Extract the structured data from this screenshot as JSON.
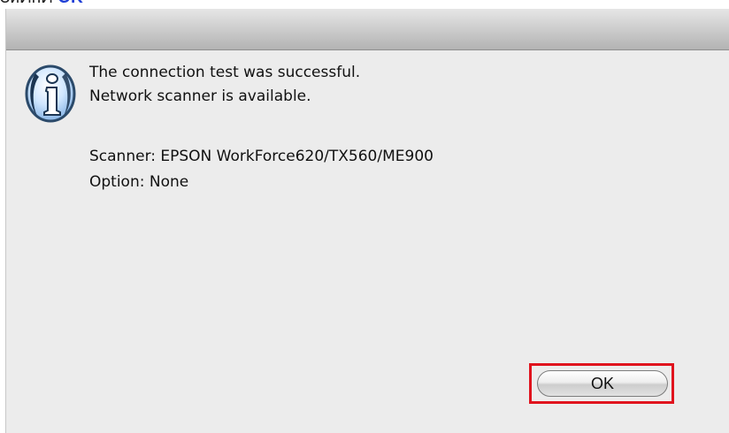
{
  "caption": {
    "prefix": "ЗиЙнЙ",
    "link": "OK"
  },
  "dialog": {
    "icon": "info-icon",
    "message_line1": "The connection test was successful.",
    "message_line2": "Network scanner is available.",
    "scanner_line": "Scanner: EPSON WorkForce620/TX560/ME900",
    "option_line": "Option: None",
    "ok_label": "OK"
  },
  "colors": {
    "highlight": "#e0141e",
    "caption_link": "#1f3fd6",
    "dialog_bg": "#ececec"
  }
}
